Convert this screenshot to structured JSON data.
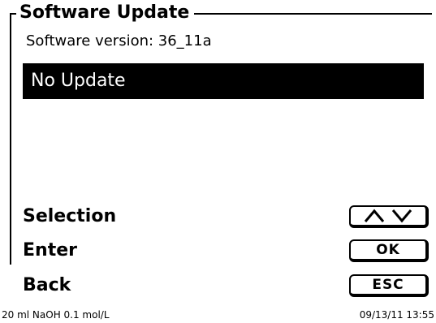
{
  "header": {
    "title": "Software Update",
    "version_text": "Software version: 36_11a"
  },
  "list": {
    "items": [
      "No Update"
    ],
    "selected_index": 0
  },
  "softkeys": [
    {
      "label": "Selection",
      "key": "",
      "key_icons": [
        "arrow-up-icon",
        "arrow-down-icon"
      ]
    },
    {
      "label": "Enter",
      "key": "OK"
    },
    {
      "label": "Back",
      "key": "ESC"
    }
  ],
  "status": {
    "left": "20 ml NaOH 0.1 mol/L",
    "right": "09/13/11 13:55"
  }
}
